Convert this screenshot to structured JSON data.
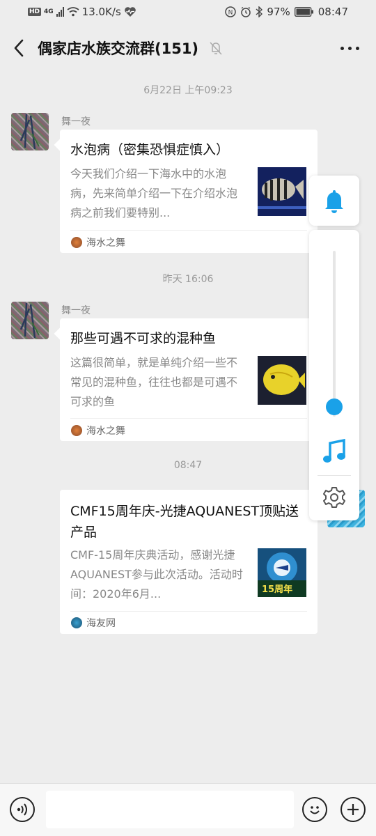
{
  "status_bar": {
    "hd": "HD",
    "network": "4G",
    "speed": "13.0K/s",
    "battery": "97%",
    "time": "08:47"
  },
  "header": {
    "title": "偶家店水族交流群(151)"
  },
  "messages": [
    {
      "timestamp": "6月22日 上午09:23",
      "sender": "舞一夜",
      "title": "水泡病（密集恐惧症慎入）",
      "desc": "今天我们介绍一下海水中的水泡病，先来简单介绍一下在介绍水泡病之前我们要特别...",
      "source": "海水之舞"
    },
    {
      "timestamp": "昨天 16:06",
      "sender": "舞一夜",
      "title": "那些可遇不可求的混种鱼",
      "desc": "这篇很简单，就是单纯介绍一些不常见的混种鱼，往往也都是可遇不可求的鱼",
      "source": "海水之舞"
    },
    {
      "timestamp": "08:47",
      "title": "CMF15周年庆-光捷AQUANEST顶贴送产品",
      "desc": "CMF-15周年庆典活动，感谢光捷AQUANEST参与此次活动。活动时间：2020年6月...",
      "source": "海友网",
      "thumb_text": "15周年"
    }
  ],
  "volume_panel": {
    "level": 0.0
  },
  "colors": {
    "accent": "#1aa1e8",
    "background": "#ededed"
  },
  "icons": [
    "bell-icon",
    "music-note-icon",
    "gear-icon",
    "voice-icon",
    "emoji-icon",
    "plus-icon",
    "back-icon",
    "mute-icon",
    "more-icon"
  ]
}
